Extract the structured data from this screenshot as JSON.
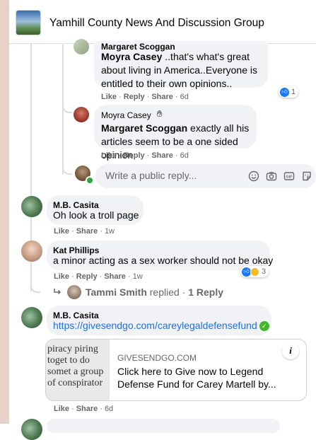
{
  "header": {
    "group_title": "Yamhill County News And Discussion Group"
  },
  "comments": [
    {
      "author": "Margaret Scoggan",
      "mention": "Moyra Casey",
      "text": " ..that's what's great about living in America..Everyone is entitled to their own opinions..",
      "actions": {
        "like": "Like",
        "reply": "Reply",
        "share": "Share",
        "time": "6d"
      },
      "reaction_count": "1"
    },
    {
      "author": "Moyra Casey",
      "mention": "Margaret Scoggan",
      "text": " exactly all his articles seem to be a one sided opinion.",
      "actions": {
        "like": "Like",
        "reply": "Reply",
        "share": "Share",
        "time": "6d"
      }
    },
    {
      "author": "M.B. Casita",
      "text": "Oh look a troll page",
      "actions": {
        "like": "Like",
        "share": "Share",
        "time": "1w"
      }
    },
    {
      "author": "Kat Phillips",
      "text": "a minor acting as a sex worker should not be okay",
      "actions": {
        "like": "Like",
        "reply": "Reply",
        "share": "Share",
        "time": "1w"
      },
      "reaction_count": "3",
      "replies_summary": {
        "name": "Tammi Smith",
        "suffix": " replied · ",
        "count": "1 Reply"
      }
    },
    {
      "author": "M.B. Casita",
      "link_text": "https://givesendgo.com/careylegaldefensefund",
      "link_card": {
        "thumb_text": "piracy piring toget to do somet a group of conspirator",
        "domain": "GIVESENDGO.COM",
        "title": "Click here to Give now to Legend Defense Fund for Carey Martell by..."
      },
      "actions": {
        "like": "Like",
        "share": "Share",
        "time": "6d"
      }
    }
  ],
  "reply_box": {
    "placeholder": "Write a public reply..."
  },
  "colors": {
    "bubble": "#f0f2f5",
    "link": "#216fdb",
    "like_blue": "#1877f2",
    "verified_green": "#42b72a"
  }
}
